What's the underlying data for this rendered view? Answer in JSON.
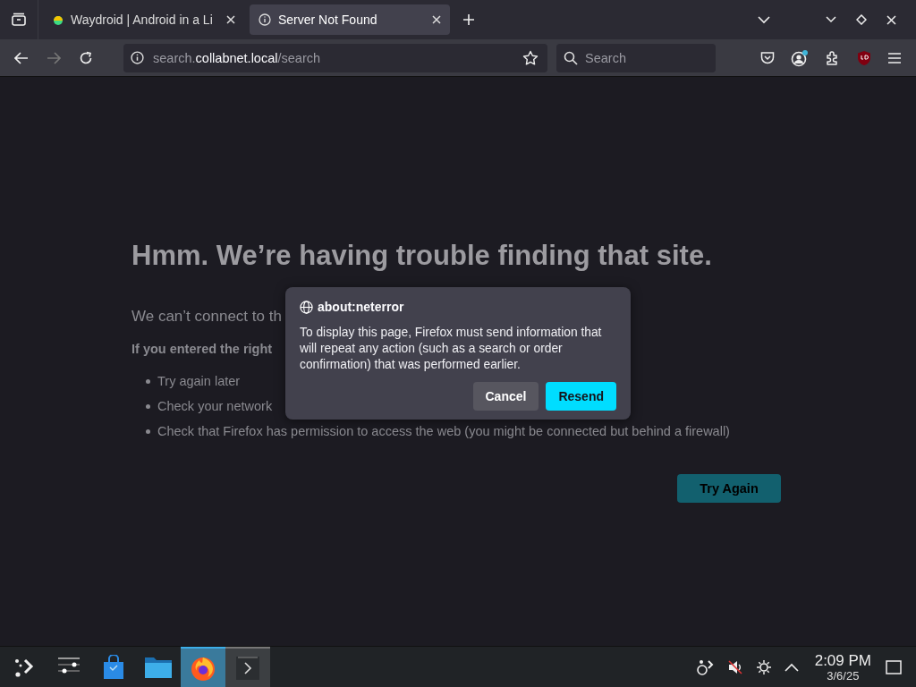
{
  "tabs": [
    {
      "label": "Waydroid | Android in a Li",
      "kind": "site",
      "selected": false
    },
    {
      "label": "Server Not Found",
      "kind": "info",
      "selected": true
    }
  ],
  "address": {
    "prefix": "search.",
    "domain": "collabnet.local",
    "path": "/search"
  },
  "search": {
    "placeholder": "Search"
  },
  "page": {
    "heading": "Hmm. We’re having trouble finding that site.",
    "intro": "We can’t connect to th",
    "advice": "If you entered the right",
    "bullets": [
      "Try again later",
      "Check your network",
      "Check that Firefox has permission to access the web (you might be connected but behind a firewall)"
    ],
    "try_again": "Try Again"
  },
  "dialog": {
    "title": "about:neterror",
    "message": "To display this page, Firefox must send information that will repeat any action (such as a search or order confirmation) that was performed earlier.",
    "buttons": [
      {
        "label": "Cancel",
        "kind": "secondary"
      },
      {
        "label": "Resend",
        "kind": "primary"
      }
    ]
  },
  "taskbar": {
    "items": [
      {
        "kind": "launcher",
        "selected": false,
        "open": false
      },
      {
        "kind": "settings",
        "selected": false,
        "open": false
      },
      {
        "kind": "store",
        "selected": false,
        "open": false
      },
      {
        "kind": "files",
        "selected": false,
        "open": false
      },
      {
        "kind": "firefox",
        "selected": true,
        "open": true
      },
      {
        "kind": "terminal",
        "selected": false,
        "open": true
      }
    ],
    "time": "2:09 PM",
    "date": "3/6/25"
  }
}
